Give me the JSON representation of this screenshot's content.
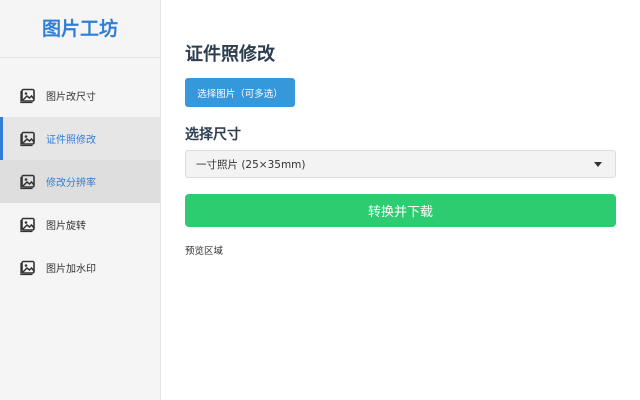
{
  "sidebar": {
    "brand": "图片工坊",
    "items": [
      {
        "label": "图片改尺寸",
        "icon": "image-icon",
        "state": "normal"
      },
      {
        "label": "证件照修改",
        "icon": "image-icon",
        "state": "active"
      },
      {
        "label": "修改分辨率",
        "icon": "image-icon",
        "state": "hovered"
      },
      {
        "label": "图片旋转",
        "icon": "image-icon",
        "state": "normal"
      },
      {
        "label": "图片加水印",
        "icon": "image-icon",
        "state": "normal"
      }
    ]
  },
  "main": {
    "title": "证件照修改",
    "pick_button": "选择图片（可多选）",
    "size_label": "选择尺寸",
    "size_select": {
      "value": "一寸照片 (25×35mm)"
    },
    "convert_button": "转换并下载",
    "preview_label": "预览区域"
  },
  "colors": {
    "brand": "#2f7fd6",
    "pick_button": "#3498db",
    "convert_button": "#2ecc71",
    "sidebar_bg": "#f5f5f5"
  }
}
